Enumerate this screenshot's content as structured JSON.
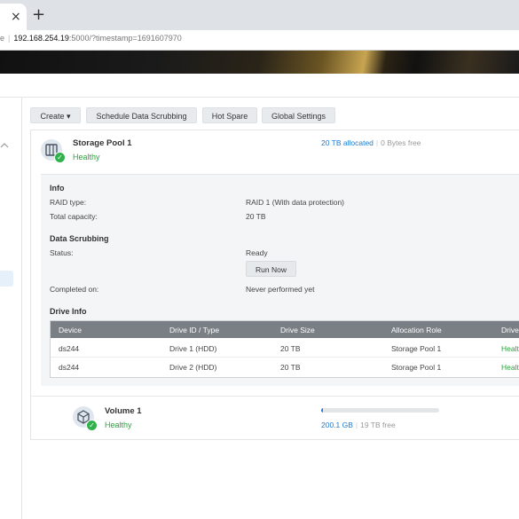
{
  "browser": {
    "tab_close": "×",
    "new_tab": "+",
    "url_prefix": "e",
    "url_host": "192.168.254.19",
    "url_rest": ":5000/?timestamp=1691607970"
  },
  "toolbar": {
    "create_label": "Create ▾",
    "scrubbing_label": "Schedule Data Scrubbing",
    "hot_spare_label": "Hot Spare",
    "global_settings_label": "Global Settings"
  },
  "pool": {
    "name": "Storage Pool 1",
    "status": "Healthy",
    "allocated": "20 TB allocated",
    "free": "0 Bytes free",
    "info": {
      "heading": "Info",
      "raid_label": "RAID type:",
      "raid_value": "RAID 1 (With data protection)",
      "capacity_label": "Total capacity:",
      "capacity_value": "20 TB"
    },
    "scrubbing": {
      "heading": "Data Scrubbing",
      "status_label": "Status:",
      "status_value": "Ready",
      "run_now": "Run Now",
      "completed_label": "Completed on:",
      "completed_value": "Never performed yet"
    },
    "drive_info": {
      "heading": "Drive Info",
      "columns": [
        "Device",
        "Drive ID / Type",
        "Drive Size",
        "Allocation Role",
        "Drive"
      ],
      "rows": [
        [
          "ds244",
          "Drive 1 (HDD)",
          "20 TB",
          "Storage Pool 1",
          "Healt"
        ],
        [
          "ds244",
          "Drive 2 (HDD)",
          "20 TB",
          "Storage Pool 1",
          "Healt"
        ]
      ]
    }
  },
  "volume": {
    "name": "Volume 1",
    "status": "Healthy",
    "used": "200.1 GB",
    "free": "19 TB free",
    "usage_fraction": 0.01
  },
  "colors": {
    "accent": "#1a7bd4",
    "healthy": "#2ba33e",
    "table_header": "#7a7f85"
  },
  "icons": {
    "pool": "storage-pool-icon",
    "volume": "volume-cube-icon",
    "status": "check-circle-icon"
  }
}
